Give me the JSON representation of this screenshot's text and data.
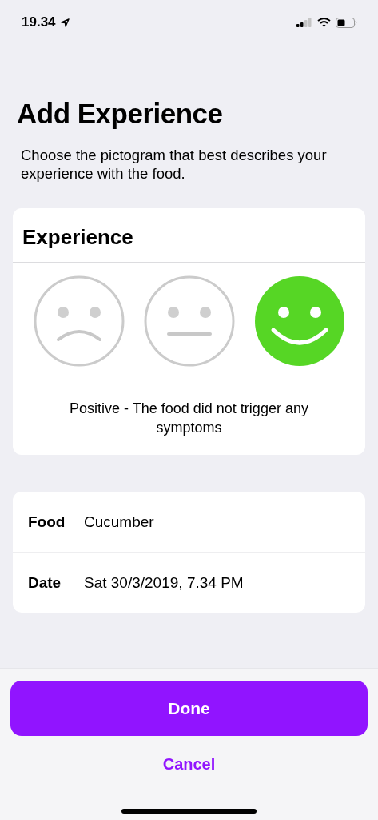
{
  "status_bar": {
    "time": "19.34"
  },
  "title": "Add Experience",
  "description": "Choose the pictogram that best describes your experience with the food.",
  "experience": {
    "heading": "Experience",
    "faces": [
      {
        "kind": "negative",
        "selected": false
      },
      {
        "kind": "neutral",
        "selected": false
      },
      {
        "kind": "positive",
        "selected": true
      }
    ],
    "caption": "Positive - The food did not trigger any symptoms"
  },
  "details": [
    {
      "label": "Food",
      "value": "Cucumber"
    },
    {
      "label": "Date",
      "value": "Sat 30/3/2019, 7.34 PM"
    }
  ],
  "buttons": {
    "primary": "Done",
    "secondary": "Cancel"
  }
}
